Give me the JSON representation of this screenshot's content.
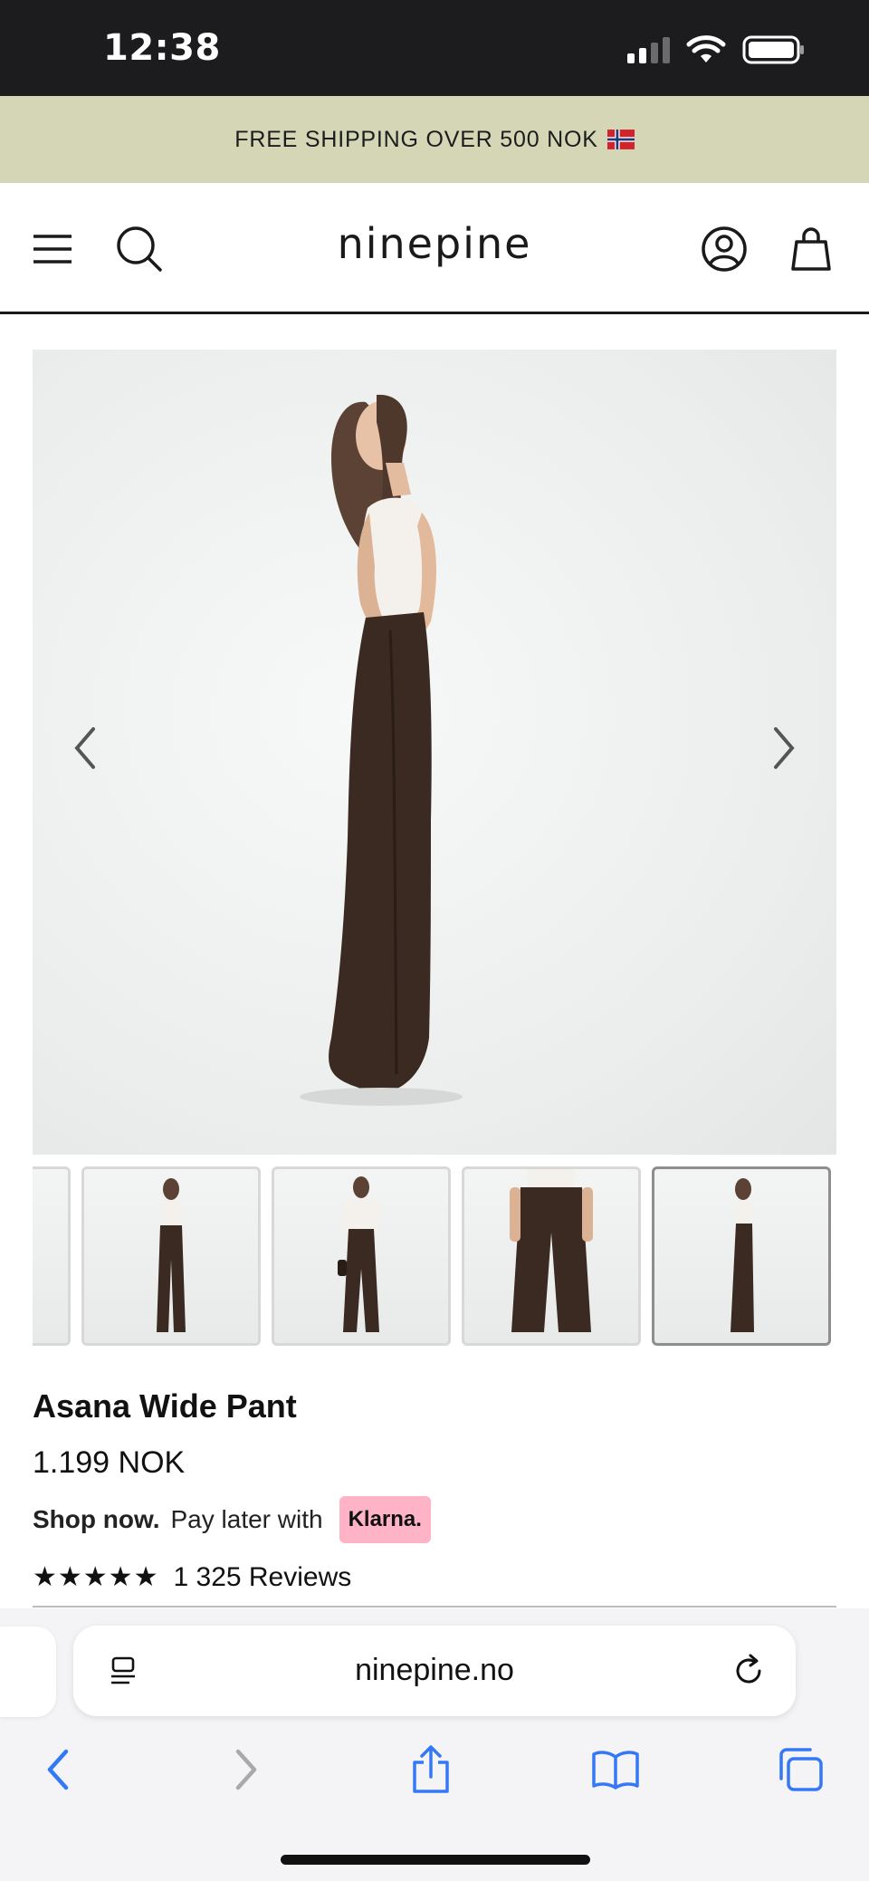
{
  "status_bar": {
    "time": "12:38"
  },
  "promo": {
    "text": "FREE SHIPPING OVER 500 NOK",
    "flag_icon": "norway-flag-icon"
  },
  "header": {
    "brand": "ninepine",
    "menu_icon": "hamburger-menu-icon",
    "search_icon": "search-icon",
    "account_icon": "user-account-icon",
    "cart_icon": "shopping-bag-icon"
  },
  "product": {
    "title": "Asana Wide Pant",
    "price": "1.199 NOK",
    "klarna": {
      "lead": "Shop now.",
      "text": "Pay later with",
      "badge": "Klarna."
    },
    "rating": {
      "stars": "★★★★★",
      "reviews": "1 325 Reviews"
    },
    "gallery": {
      "thumbnail_count_visible": 5,
      "active_thumbnail": 5
    }
  },
  "browser": {
    "url": "ninepine.no",
    "toolbar": [
      "back",
      "forward",
      "share",
      "bookmarks",
      "tabs"
    ]
  },
  "colors": {
    "promo_bg": "#d4d6b6",
    "klarna_pink": "#ffb3c7",
    "safari_blue": "#3478f6",
    "pant_brown": "#3a2a22"
  }
}
